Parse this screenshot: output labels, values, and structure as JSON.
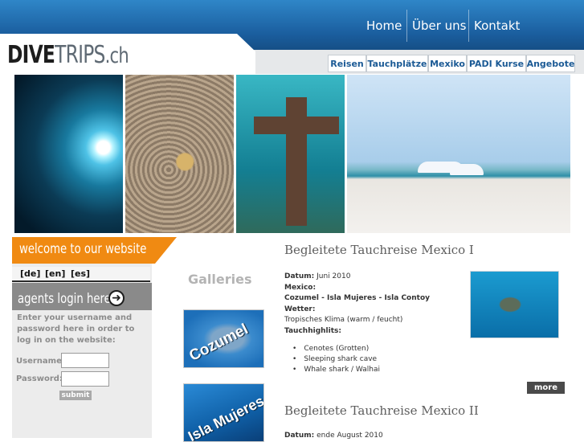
{
  "site": {
    "logo_prefix": "DIVE",
    "logo_suffix": "TRIPS",
    "logo_tld": ".ch"
  },
  "top_nav": [
    "Home",
    "Über uns",
    "Kontakt"
  ],
  "sub_nav": [
    "Reisen",
    "Tauchplätze",
    "Mexiko",
    "PADI Kurse",
    "Angebote"
  ],
  "sidebar": {
    "welcome": "welcome to our website",
    "languages": [
      "[de]",
      "[en]",
      "[es]"
    ],
    "login_title": "agents login here",
    "login_info": "Enter your username and password here in order to log in on the website:",
    "username_label": "Username:",
    "password_label": "Password:",
    "submit_label": "submit"
  },
  "galleries": {
    "title": "Galleries",
    "items": [
      "Cozumel",
      "Isla Mujeres"
    ]
  },
  "articles": [
    {
      "title": "Begleitete Tauchreise Mexico I",
      "date_label": "Datum:",
      "date_value": "Juni 2010",
      "region_label": "Mexico:",
      "region_value": "Cozumel - Isla Mujeres - Isla Contoy",
      "weather_label": "Wetter:",
      "weather_value": "Tropisches Klima (warm / feucht)",
      "highlights_label": "Tauchhighlits:",
      "highlights": [
        "Cenotes (Grotten)",
        "Sleeping shark cave",
        "Whale shark / Walhai"
      ],
      "more_label": "more"
    },
    {
      "title": "Begleitete Tauchreise Mexico II",
      "date_label": "Datum:",
      "date_value": "ende August 2010"
    }
  ],
  "icons": {
    "login_arrow": "arrow-right-circle-icon",
    "list_bullet": "bullet-icon"
  },
  "colors": {
    "header_blue": "#1a5d9d",
    "orange": "#f08a12",
    "nav_text": "#1b5a95"
  }
}
